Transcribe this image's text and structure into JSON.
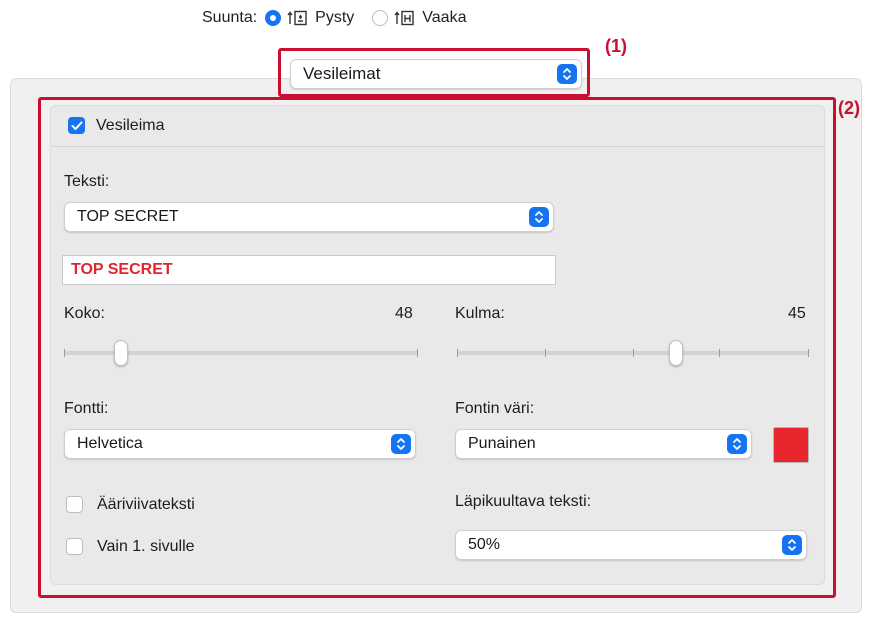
{
  "orientation": {
    "label": "Suunta:",
    "options": [
      {
        "label": "Pysty",
        "selected": true
      },
      {
        "label": "Vaaka",
        "selected": false
      }
    ]
  },
  "panel_selector": {
    "value": "Vesileimat"
  },
  "annotations": {
    "one": "(1)",
    "two": "(2)"
  },
  "watermark": {
    "enable_label": "Vesileima",
    "enabled": true,
    "text_label": "Teksti:",
    "text_select": "TOP SECRET",
    "text_field": "TOP SECRET",
    "size_label": "Koko:",
    "size_value": "48",
    "angle_label": "Kulma:",
    "angle_value": "45",
    "font_label": "Fontti:",
    "font_value": "Helvetica",
    "color_label": "Fontin väri:",
    "color_value": "Punainen",
    "color_swatch": "#e8262d",
    "outline_label": "Ääriviivateksti",
    "outline_checked": false,
    "first_page_label": "Vain 1. sivulle",
    "first_page_checked": false,
    "transparency_label": "Läpikuultava teksti:",
    "transparency_value": "50%"
  },
  "colors": {
    "accent": "#1673f2",
    "annotation": "#c8102e"
  }
}
